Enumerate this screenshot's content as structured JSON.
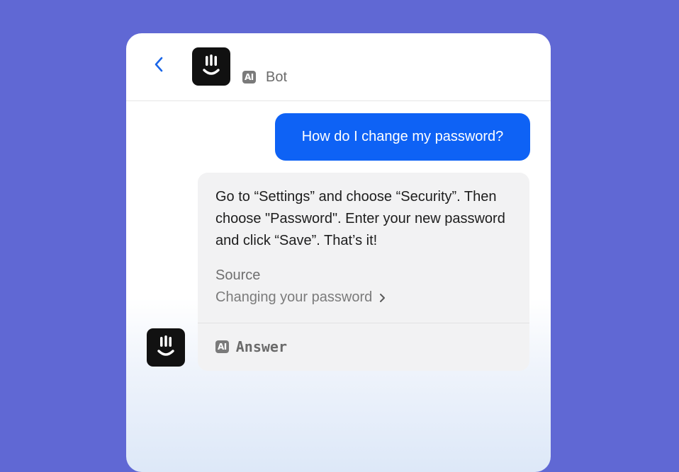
{
  "header": {
    "back_icon": "chevron-left-icon",
    "bot_avatar_icon": "smiley-logo-icon",
    "ai_badge": "AI",
    "bot_name": "Bot"
  },
  "conversation": {
    "user_message": "How do I change my password?",
    "bot_reply": {
      "text": "Go to “Settings” and choose “Security”. Then choose \"Password\". Enter your new password and click “Save”. That’s it!",
      "source_label": "Source",
      "source_link": "Changing your password",
      "footer_badge": "AI",
      "footer_label": "Answer"
    }
  },
  "colors": {
    "background": "#6068d4",
    "user_bubble": "#0e62f5",
    "bot_bubble": "#f2f2f3",
    "accent_back": "#1a66e8",
    "avatar": "#111111"
  }
}
